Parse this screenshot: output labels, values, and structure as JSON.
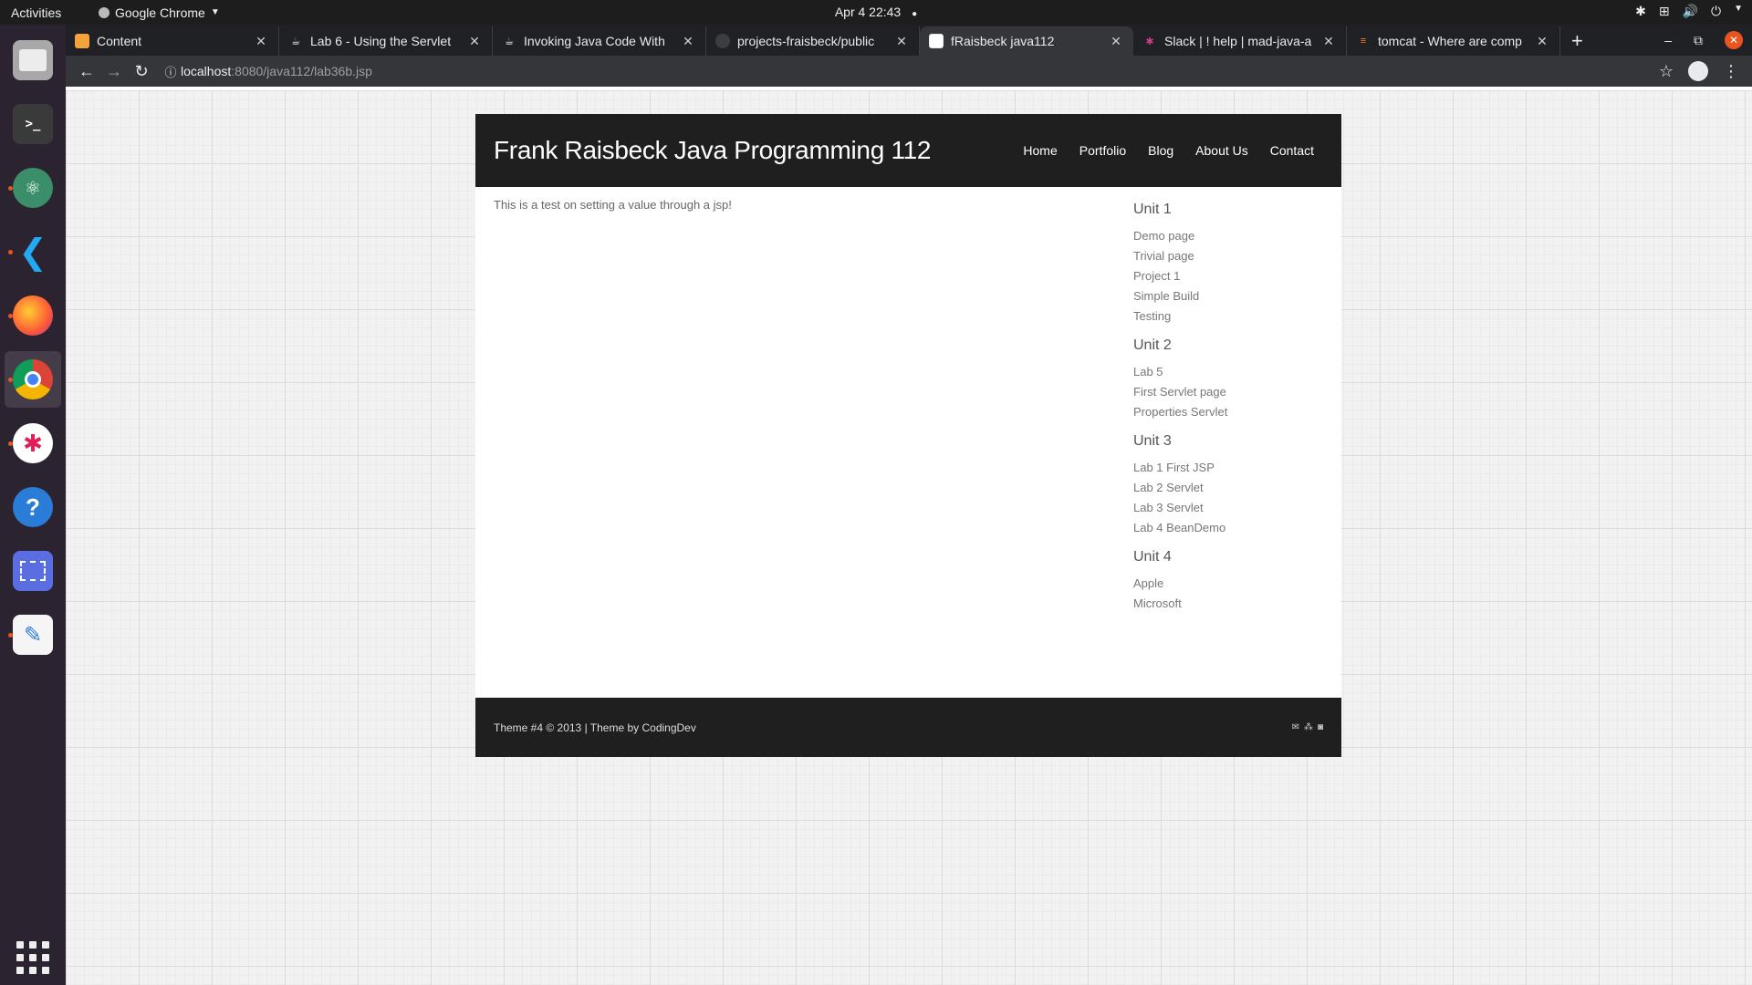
{
  "topbar": {
    "activities": "Activities",
    "app_name": "Google Chrome",
    "clock": "Apr 4  22:43"
  },
  "dock": {
    "items": [
      {
        "name": "files",
        "color": "#8c8c8c"
      },
      {
        "name": "terminal",
        "color": "#3a3a3a"
      },
      {
        "name": "atom",
        "color": "#3a8f6a"
      },
      {
        "name": "vscode",
        "color": "#1f7fd1"
      },
      {
        "name": "firefox",
        "color": "#ff7139"
      },
      {
        "name": "chrome",
        "color": "#4285f4"
      },
      {
        "name": "slack",
        "color": "#ffffff"
      },
      {
        "name": "help",
        "color": "#2a7dd6"
      },
      {
        "name": "screenshot",
        "color": "#5b6ee1"
      },
      {
        "name": "text-editor",
        "color": "#f5f5f5"
      }
    ]
  },
  "browser": {
    "tabs": [
      {
        "title": "Content",
        "fav_color": "#f4a33b",
        "active": false
      },
      {
        "title": "Lab 6 - Using the Servlet",
        "fav_color": "#e8eaed",
        "active": false
      },
      {
        "title": "Invoking Java Code With",
        "fav_color": "#e8eaed",
        "active": false
      },
      {
        "title": "projects-fraisbeck/public",
        "fav_color": "#9aa0a6",
        "active": false
      },
      {
        "title": "fRaisbeck java112",
        "fav_color": "#e8eaed",
        "active": true
      },
      {
        "title": "Slack | ! help | mad-java-a",
        "fav_color": "#d63a8a",
        "active": false
      },
      {
        "title": "tomcat - Where are comp",
        "fav_color": "#f48024",
        "active": false
      }
    ],
    "url_host": "localhost",
    "url_path": ":8080/java112/lab36b.jsp"
  },
  "site": {
    "title": "Frank Raisbeck Java Programming 112",
    "nav": [
      "Home",
      "Portfolio",
      "Blog",
      "About Us",
      "Contact"
    ],
    "content_text": "This is a test on setting a value through a jsp!",
    "units": [
      {
        "title": "Unit 1",
        "links": [
          "Demo page",
          "Trivial page",
          "Project 1",
          "Simple Build",
          "Testing"
        ]
      },
      {
        "title": "Unit 2",
        "links": [
          "Lab 5",
          "First Servlet page",
          "Properties Servlet"
        ]
      },
      {
        "title": "Unit 3",
        "links": [
          "Lab 1 First JSP",
          "Lab 2 Servlet",
          "Lab 3 Servlet",
          "Lab 4 BeanDemo"
        ]
      },
      {
        "title": "Unit 4",
        "links": [
          "Apple",
          "Microsoft"
        ]
      }
    ],
    "footer_text": "Theme #4 © 2013 | Theme by CodingDev"
  }
}
